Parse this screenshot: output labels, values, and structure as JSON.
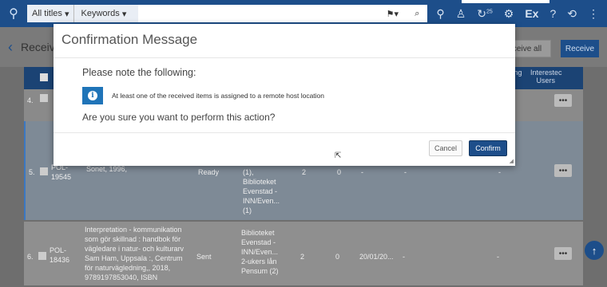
{
  "header": {
    "search_scope": "All titles",
    "search_type": "Keywords",
    "icons": [
      "menu-icon",
      "user-icon",
      "notification-icon",
      "task-icon",
      "ex-icon",
      "help-icon",
      "history-icon",
      "more-icon"
    ],
    "notification_count": "25"
  },
  "page": {
    "title": "Receive",
    "receive_all_label": "ceive all",
    "receive_label": "Receive"
  },
  "table": {
    "col_receiving": "ving",
    "col_receiving2": "e",
    "col_interested": "Interestec",
    "col_interested2": "Users",
    "rows": [
      {
        "num": "4.",
        "pol": "F\n1"
      },
      {
        "num": "5.",
        "pol": "POL-\n19545",
        "title": "Sonet, 1996,",
        "title_top": "Gyni 36 Nestle iyooppiak, oslo,",
        "status": "Ready",
        "location": "(1),\nBiblioteket\nEvenstad -\nINN/Even...\n(1)",
        "qty": "2",
        "received": "0",
        "date": "-",
        "dash": "-",
        "interest": "-"
      },
      {
        "num": "6.",
        "pol": "POL-\n18436",
        "title": "Interpretation - kommunikation\nsom gör skillnad : handbok för\nvägledare i natur- och kulturarv\nSam Ham, Uppsala :, Centrum\nför naturvägledning,, 2018,\n9789197853040, ISBN",
        "status": "Sent",
        "location": "Biblioteket\nEvenstad -\nINN/Even...\n2-ukers lån\nPensum (2)",
        "qty": "2",
        "received": "0",
        "date": "20/01/20...",
        "dash": "-",
        "interest": "-"
      }
    ]
  },
  "modal": {
    "title": "Confirmation Message",
    "heading": "Please note the following:",
    "info": "At least one of the received items is assigned to a remote host location",
    "question": "Are you sure you want to perform this action?",
    "cancel_label": "Cancel",
    "confirm_label": "Confirm"
  },
  "colors": {
    "primary": "#1d4e8a",
    "info": "#1f74b8"
  }
}
